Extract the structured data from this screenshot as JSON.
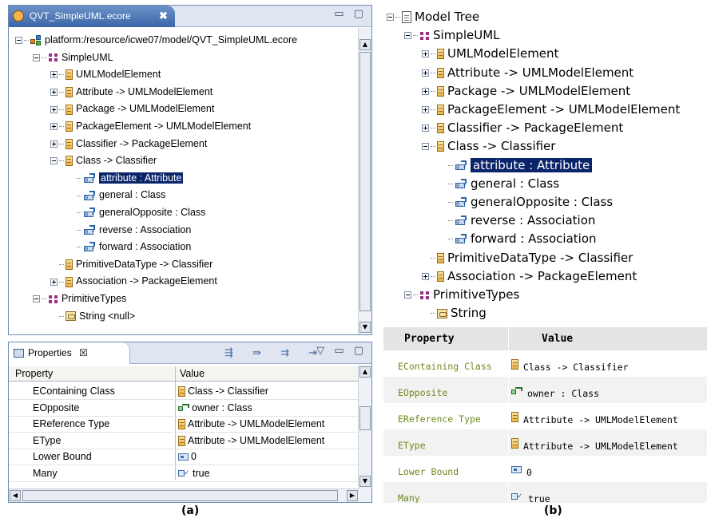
{
  "left": {
    "caption": "(a)",
    "editor_tab": {
      "title": "QVT_SimpleUML.ecore",
      "close": "✖",
      "window_controls": "▭ ▢"
    },
    "tree": [
      {
        "label": "platform:/resource/icwe07/model/QVT_SimpleUML.ecore",
        "icon": "resource-icon",
        "expander": "minus",
        "depth": 0
      },
      {
        "label": "SimpleUML",
        "icon": "package-icon",
        "expander": "minus",
        "depth": 1
      },
      {
        "label": "UMLModelElement",
        "icon": "class-icon",
        "expander": "plus",
        "depth": 2
      },
      {
        "label": "Attribute -> UMLModelElement",
        "icon": "class-icon",
        "expander": "plus",
        "depth": 2
      },
      {
        "label": "Package -> UMLModelElement",
        "icon": "class-icon",
        "expander": "plus",
        "depth": 2
      },
      {
        "label": "PackageElement -> UMLModelElement",
        "icon": "class-icon",
        "expander": "plus",
        "depth": 2
      },
      {
        "label": "Classifier -> PackageElement",
        "icon": "class-icon",
        "expander": "plus",
        "depth": 2
      },
      {
        "label": "Class -> Classifier",
        "icon": "class-icon",
        "expander": "minus",
        "depth": 2
      },
      {
        "label": "attribute : Attribute",
        "icon": "reference-icon",
        "expander": "none",
        "depth": 3,
        "selected": true
      },
      {
        "label": "general : Class",
        "icon": "reference-icon",
        "expander": "none",
        "depth": 3
      },
      {
        "label": "generalOpposite : Class",
        "icon": "reference-icon",
        "expander": "none",
        "depth": 3
      },
      {
        "label": "reverse : Association",
        "icon": "reference-icon",
        "expander": "none",
        "depth": 3
      },
      {
        "label": "forward : Association",
        "icon": "reference-icon",
        "expander": "none",
        "depth": 3
      },
      {
        "label": "PrimitiveDataType -> Classifier",
        "icon": "class-icon",
        "expander": "none",
        "depth": 2
      },
      {
        "label": "Association -> PackageElement",
        "icon": "class-icon",
        "expander": "plus",
        "depth": 2
      },
      {
        "label": "PrimitiveTypes",
        "icon": "package-icon",
        "expander": "minus",
        "depth": 1
      },
      {
        "label": "String <null>",
        "icon": "datatype-icon",
        "expander": "none",
        "depth": 2
      }
    ],
    "properties": {
      "tab_title": "Properties",
      "tab_close": "☒",
      "toolbar_glyphs": "⇶ ⇛ ⇉ ⇥",
      "window_controls": "▽ ▭ ▢",
      "headers": {
        "property": "Property",
        "value": "Value"
      },
      "rows": [
        {
          "property": "EContaining Class",
          "value": "Class -> Classifier",
          "icon": "class-icon"
        },
        {
          "property": "EOpposite",
          "value": "owner : Class",
          "icon": "attribute-ref-icon"
        },
        {
          "property": "EReference Type",
          "value": "Attribute -> UMLModelElement",
          "icon": "class-icon"
        },
        {
          "property": "EType",
          "value": "Attribute -> UMLModelElement",
          "icon": "class-icon"
        },
        {
          "property": "Lower Bound",
          "value": "0",
          "icon": "integer-icon"
        },
        {
          "property": "Many",
          "value": "true",
          "icon": "boolean-icon"
        }
      ]
    }
  },
  "right": {
    "caption": "(b)",
    "tree": [
      {
        "label": "Model Tree",
        "icon": "document-icon",
        "expander": "minus",
        "depth": 0
      },
      {
        "label": "SimpleUML",
        "icon": "package-icon",
        "expander": "minus",
        "depth": 1
      },
      {
        "label": "UMLModelElement",
        "icon": "class-icon",
        "expander": "plus",
        "depth": 2
      },
      {
        "label": "Attribute -> UMLModelElement",
        "icon": "class-icon",
        "expander": "plus",
        "depth": 2
      },
      {
        "label": "Package -> UMLModelElement",
        "icon": "class-icon",
        "expander": "plus",
        "depth": 2
      },
      {
        "label": "PackageElement -> UMLModelElement",
        "icon": "class-icon",
        "expander": "plus",
        "depth": 2
      },
      {
        "label": "Classifier -> PackageElement",
        "icon": "class-icon",
        "expander": "plus",
        "depth": 2
      },
      {
        "label": "Class -> Classifier",
        "icon": "class-icon",
        "expander": "minus",
        "depth": 2
      },
      {
        "label": "attribute : Attribute",
        "icon": "reference-icon",
        "expander": "none",
        "depth": 3,
        "selected": true
      },
      {
        "label": "general : Class",
        "icon": "reference-icon",
        "expander": "none",
        "depth": 3
      },
      {
        "label": "generalOpposite : Class",
        "icon": "reference-icon",
        "expander": "none",
        "depth": 3
      },
      {
        "label": "reverse : Association",
        "icon": "reference-icon",
        "expander": "none",
        "depth": 3
      },
      {
        "label": "forward : Association",
        "icon": "reference-icon",
        "expander": "none",
        "depth": 3
      },
      {
        "label": "PrimitiveDataType -> Classifier",
        "icon": "class-icon",
        "expander": "none",
        "depth": 2
      },
      {
        "label": "Association -> PackageElement",
        "icon": "class-icon",
        "expander": "plus",
        "depth": 2
      },
      {
        "label": "PrimitiveTypes",
        "icon": "package-icon",
        "expander": "minus",
        "depth": 1
      },
      {
        "label": "String",
        "icon": "datatype-icon",
        "expander": "none",
        "depth": 2
      }
    ],
    "properties": {
      "headers": {
        "property": "Property",
        "value": "Value"
      },
      "rows": [
        {
          "property": "EContaining Class",
          "value": "Class -> Classifier",
          "icon": "class-icon"
        },
        {
          "property": "EOpposite",
          "value": "owner : Class",
          "icon": "attribute-ref-icon"
        },
        {
          "property": "EReference Type",
          "value": "Attribute -> UMLModelElement",
          "icon": "class-icon"
        },
        {
          "property": "EType",
          "value": "Attribute -> UMLModelElement",
          "icon": "class-icon"
        },
        {
          "property": "Lower Bound",
          "value": "0",
          "icon": "integer-icon"
        },
        {
          "property": "Many",
          "value": "true",
          "icon": "boolean-icon"
        }
      ]
    }
  },
  "colors": {
    "selection": "#0a246a",
    "active_tab": "#3b66aa",
    "property_name_green": "#6d8a1a",
    "package_purple": "#9b2f86"
  }
}
